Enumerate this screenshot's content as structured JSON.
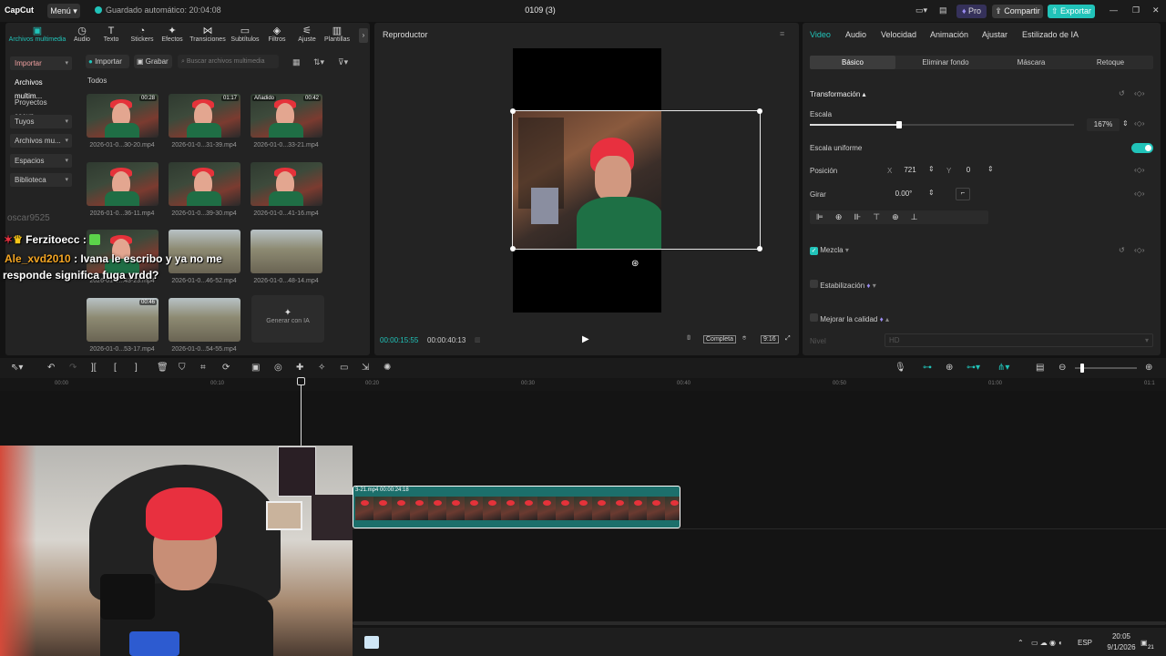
{
  "topbar": {
    "logo": "CapCut",
    "menu": "Menú",
    "autosave": "Guardado automático: 20:04:08",
    "project_title": "0109 (3)",
    "pro": "Pro",
    "share": "Compartir",
    "export": "Exportar"
  },
  "toolbar_tabs": [
    {
      "label": "Archivos multimedia",
      "icon": "media-icon"
    },
    {
      "label": "Audio",
      "icon": "audio-icon"
    },
    {
      "label": "Texto",
      "icon": "text-icon"
    },
    {
      "label": "Stickers",
      "icon": "sticker-icon"
    },
    {
      "label": "Efectos",
      "icon": "effects-icon"
    },
    {
      "label": "Transiciones",
      "icon": "transitions-icon"
    },
    {
      "label": "Subtítulos",
      "icon": "subtitles-icon"
    },
    {
      "label": "Filtros",
      "icon": "filters-icon"
    },
    {
      "label": "Ajuste",
      "icon": "adjust-icon"
    },
    {
      "label": "Plantillas",
      "icon": "templates-icon"
    }
  ],
  "media_sidebar": {
    "items": [
      "Importar",
      "Archivos multim...",
      "Proyectos secun...",
      "Tuyos",
      "Archivos mu...",
      "Espacios",
      "Biblioteca"
    ]
  },
  "media_toolbar": {
    "import": "Importar",
    "record": "Grabar",
    "search_placeholder": "Buscar archivos multimedia",
    "section": "Todos"
  },
  "media_items": [
    {
      "name": "2026-01-0...30-20.mp4",
      "badge": "00:28"
    },
    {
      "name": "2026-01-0...31-39.mp4",
      "badge": "01:17"
    },
    {
      "name": "2026-01-0...33-21.mp4",
      "badge": "00:42",
      "added": "Añadido"
    },
    {
      "name": "2026-01-0...36-11.mp4",
      "badge": ""
    },
    {
      "name": "2026-01-0...39-30.mp4",
      "badge": ""
    },
    {
      "name": "2026-01-0...41-16.mp4",
      "badge": ""
    },
    {
      "name": "2026-01-0...43-23.mp4",
      "badge": ""
    },
    {
      "name": "2026-01-0...46-52.mp4",
      "badge": ""
    },
    {
      "name": "2026-01-0...48-14.mp4",
      "badge": ""
    },
    {
      "name": "2026-01-0...53-17.mp4",
      "badge": "00:46"
    },
    {
      "name": "2026-01-0...54-55.mp4",
      "badge": ""
    }
  ],
  "generate_ai": "Generar con IA",
  "player": {
    "title": "Reproductor",
    "current_time": "00:00:15:55",
    "total_time": "00:00:40:13",
    "quality": "Completa",
    "ratio": "9:16"
  },
  "props": {
    "tabs": [
      "Video",
      "Audio",
      "Velocidad",
      "Animación",
      "Ajustar",
      "Estilizado de IA"
    ],
    "subtabs": [
      "Básico",
      "Eliminar fondo",
      "Máscara",
      "Retoque"
    ],
    "transform": "Transformación",
    "scale_label": "Escala",
    "scale_value": "167%",
    "scale_fraction": 0.38,
    "uniform_scale": "Escala uniforme",
    "position_label": "Posición",
    "pos_x_label": "X",
    "pos_x": "721",
    "pos_y_label": "Y",
    "pos_y": "0",
    "rotate_label": "Girar",
    "rotate_value": "0.00°",
    "blend": "Mezcla",
    "stabilization": "Estabilización",
    "enhance": "Mejorar la calidad",
    "level_label": "Nivel",
    "level_value": "HD"
  },
  "ruler": [
    "00:00",
    "00:10",
    "00:20",
    "00:30",
    "00:40",
    "00:50",
    "01:00",
    "01:1"
  ],
  "clip": {
    "label": "3-21.mp4  00:00:24:18"
  },
  "chat": {
    "line1_user": "Ferzitoecc :",
    "line2_user": "Ale_xvd2010",
    "line2_text": ": Ivana le escribo y ya no me",
    "line3_text": "responde significa fuga vrdd?",
    "faded": "oscar9525"
  },
  "taskbar": {
    "lang": "ESP",
    "time": "20:05",
    "date": "9/1/2026",
    "notif": "21"
  }
}
